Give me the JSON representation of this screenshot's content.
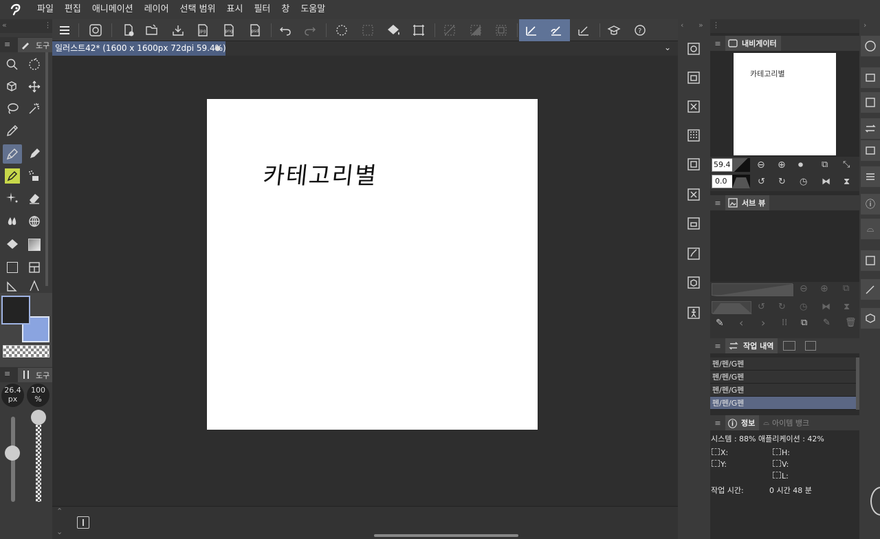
{
  "menubar": {
    "items": [
      "파일",
      "편집",
      "애니메이션",
      "레이어",
      "선택 범위",
      "표시",
      "필터",
      "창",
      "도움말"
    ]
  },
  "document": {
    "tab_title": "일러스트42* (1600 x 1600px 72dpi 59.4%)",
    "handwriting": "카테고리별"
  },
  "tool_panel": {
    "tab_label": "도구",
    "sub_tab_label": "도구"
  },
  "brush": {
    "size_value": "26.4",
    "size_unit": "px",
    "opacity_value": "100",
    "opacity_unit": "%"
  },
  "colors": {
    "main": "#232323",
    "sub": "#8aa4e0",
    "accent": "#5f7397"
  },
  "navigator": {
    "title": "내비게이터",
    "zoom_value": "59.4",
    "rotate_value": "0.0",
    "thumb_text": "카테고리별"
  },
  "subview": {
    "title": "서브 뷰"
  },
  "history": {
    "title": "작업 내역",
    "items": [
      "펜/펜/G펜",
      "펜/펜/G펜",
      "펜/펜/G펜",
      "펜/펜/G펜"
    ],
    "selected_index": 3
  },
  "info": {
    "title": "정보",
    "tab2_title": "아이템 뱅크",
    "system_line": "시스템 : 88%    애플리케이션 : 42%",
    "x_label": "X:",
    "y_label": "Y:",
    "h_label": "H:",
    "v_label": "V:",
    "l_label": "L:",
    "work_time_label": "작업 시간:",
    "work_time_value": "0 시간 48 분"
  }
}
